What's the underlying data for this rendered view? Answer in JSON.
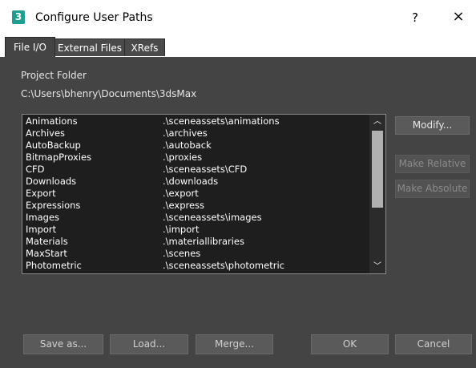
{
  "window": {
    "icon_glyph": "3",
    "title": "Configure User Paths",
    "help_label": "?",
    "close_label": "×"
  },
  "tabs": [
    {
      "label": "File I/O",
      "active": true
    },
    {
      "label": "External Files",
      "active": false
    },
    {
      "label": "XRefs",
      "active": false
    }
  ],
  "project": {
    "label": "Project Folder",
    "path": "C:\\Users\\bhenry\\Documents\\3dsMax"
  },
  "paths": [
    {
      "name": "Animations",
      "path": ".\\sceneassets\\animations"
    },
    {
      "name": "Archives",
      "path": ".\\archives"
    },
    {
      "name": "AutoBackup",
      "path": ".\\autoback"
    },
    {
      "name": "BitmapProxies",
      "path": ".\\proxies"
    },
    {
      "name": "CFD",
      "path": ".\\sceneassets\\CFD"
    },
    {
      "name": "Downloads",
      "path": ".\\downloads"
    },
    {
      "name": "Export",
      "path": ".\\export"
    },
    {
      "name": "Expressions",
      "path": ".\\express"
    },
    {
      "name": "Images",
      "path": ".\\sceneassets\\images"
    },
    {
      "name": "Import",
      "path": ".\\import"
    },
    {
      "name": "Materials",
      "path": ".\\materiallibraries"
    },
    {
      "name": "MaxStart",
      "path": ".\\scenes"
    },
    {
      "name": "Photometric",
      "path": ".\\sceneassets\\photometric"
    }
  ],
  "scrollbar": {
    "up_icon": "chevron-up-icon",
    "down_icon": "chevron-down-icon",
    "up_glyph": "︿",
    "down_glyph": "﹀"
  },
  "side_buttons": {
    "modify": "Modify...",
    "make_relative": "Make Relative",
    "make_absolute": "Make Absolute"
  },
  "bottom_buttons": {
    "save_as": "Save as...",
    "load": "Load...",
    "merge": "Merge...",
    "ok": "OK",
    "cancel": "Cancel"
  },
  "colors": {
    "dialog_bg": "#444444",
    "list_bg": "#1e1e1e",
    "titlebar_bg": "#ffffff",
    "app_icon": "#1e9e8e"
  }
}
